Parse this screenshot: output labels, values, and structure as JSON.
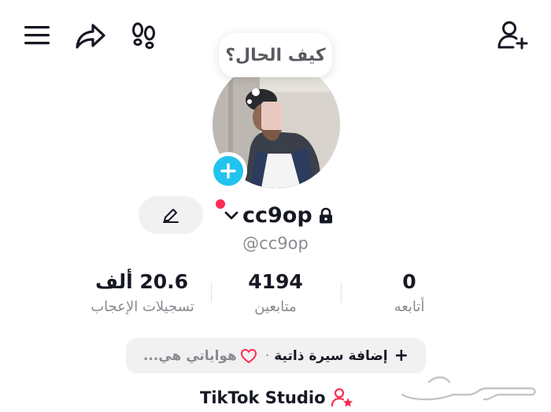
{
  "header": {
    "menu_icon": "hamburger-menu-icon",
    "share_icon": "share-arrow-icon",
    "footprint_icon": "footprints-icon",
    "add_user_icon": "add-user-icon"
  },
  "profile": {
    "status_bubble": "كيف الحال؟",
    "username": "cc9op",
    "handle": "@cc9op",
    "private": true,
    "edit_icon": "pencil-icon",
    "add_avatar_icon": "plus-icon",
    "notification_dot_color": "#fe2c55",
    "accent_color": "#20c4ee"
  },
  "stats": {
    "likes": {
      "value": "20.6 ألف",
      "label": "تسجيلات الإعجاب"
    },
    "followers": {
      "value": "4194",
      "label": "متابعين"
    },
    "following": {
      "value": "0",
      "label": "أتابعه"
    }
  },
  "bio": {
    "add_label": "إضافة سيرة ذاتية",
    "separator": "·",
    "hobbies_label": "هواياتي هي..."
  },
  "studio": {
    "label": "TikTok Studio"
  },
  "watermark": {
    "text": "حراج"
  }
}
